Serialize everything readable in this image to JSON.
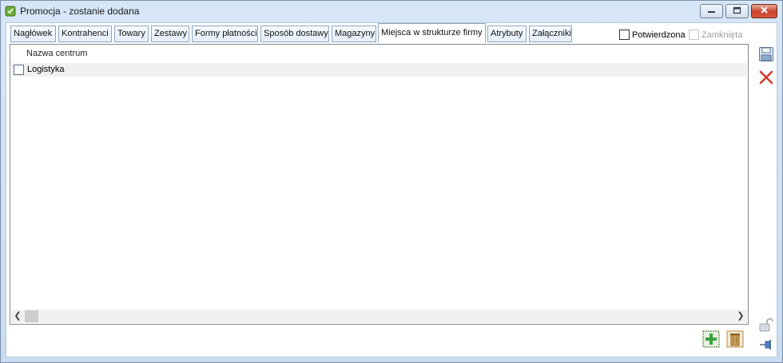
{
  "window": {
    "title": "Promocja - zostanie dodana"
  },
  "tabs": [
    {
      "label": "Nagłówek"
    },
    {
      "label": "Kontrahenci"
    },
    {
      "label": "Towary"
    },
    {
      "label": "Zestawy"
    },
    {
      "label": "Formy płatności"
    },
    {
      "label": "Sposób dostawy"
    },
    {
      "label": "Magazyny"
    },
    {
      "label": "Miejsca w strukturze firmy",
      "active": true
    },
    {
      "label": "Atrybuty"
    },
    {
      "label": "Załączniki"
    }
  ],
  "options": {
    "confirmed_label": "Potwierdzona",
    "confirmed_checked": false,
    "closed_label": "Zamknięta",
    "closed_checked": false,
    "closed_enabled": false
  },
  "grid": {
    "columns": [
      "Nazwa centrum"
    ],
    "rows": [
      {
        "checked": false,
        "name": "Logistyka"
      }
    ]
  },
  "icons": {
    "app": "app-icon",
    "minimize": "minimize-icon",
    "maximize": "maximize-icon",
    "close": "close-icon",
    "save": "save-icon",
    "cancel": "cancel-icon",
    "lock": "lock-icon",
    "pin": "pin-icon",
    "add": "add-icon",
    "delete": "trash-icon"
  },
  "colors": {
    "titlebar": "#d7e6f6",
    "tab_border": "#8da6c2",
    "add_green": "#3aa33a",
    "delete_brown": "#b98b3a",
    "cancel_red": "#d23a2a"
  }
}
